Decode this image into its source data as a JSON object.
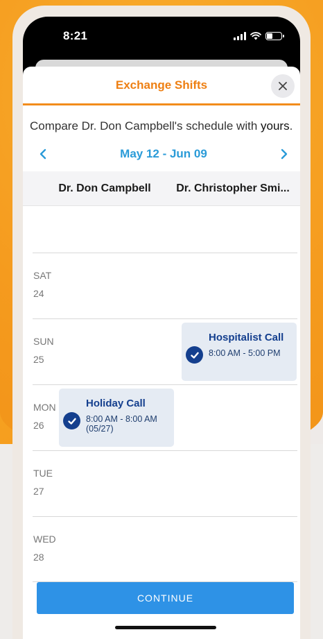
{
  "status_bar": {
    "time": "8:21"
  },
  "sheet": {
    "title": "Exchange Shifts",
    "intro_text": "Compare Dr. Don Campbell's schedule with",
    "intro_emphasis": "yours",
    "intro_suffix": "."
  },
  "date_nav": {
    "range": "May 12 - Jun 09",
    "prev_icon": "chevron-left-icon",
    "next_icon": "chevron-right-icon"
  },
  "columns": {
    "left": "Dr. Don Campbell",
    "right": "Dr. Christopher Smi..."
  },
  "days": [
    {
      "name": "SAT",
      "num": "24"
    },
    {
      "name": "SUN",
      "num": "25"
    },
    {
      "name": "MON",
      "num": "26"
    },
    {
      "name": "TUE",
      "num": "27"
    },
    {
      "name": "WED",
      "num": "28"
    }
  ],
  "shifts": {
    "hospitalist": {
      "title": "Hospitalist Call",
      "time": "8:00 AM - 5:00 PM"
    },
    "holiday": {
      "title": "Holiday Call",
      "time": "8:00 AM - 8:00 AM",
      "time_note": "(05/27)"
    }
  },
  "continue_label": "CONTINUE",
  "colors": {
    "accent_orange": "#ee7f12",
    "link_blue": "#2a9bd8",
    "shift_navy": "#143f8e",
    "button_blue": "#2e92e6"
  }
}
